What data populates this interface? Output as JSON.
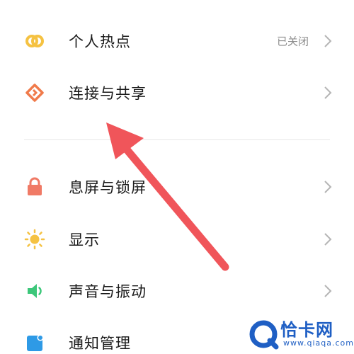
{
  "settings": {
    "hotspot": {
      "label": "个人热点",
      "status": "已关闭",
      "icon": "hotspot-icon",
      "color": "#f5c242"
    },
    "connect_share": {
      "label": "连接与共享",
      "icon": "connection-share-icon",
      "color": "#f07a4a"
    },
    "lock_screen": {
      "label": "息屏与锁屏",
      "icon": "lock-icon",
      "color": "#f07a66"
    },
    "display": {
      "label": "显示",
      "icon": "sun-icon",
      "color": "#f5c242"
    },
    "sound": {
      "label": "声音与振动",
      "icon": "speaker-icon",
      "color": "#3cc77a"
    },
    "notifications": {
      "label": "通知管理",
      "icon": "notification-icon",
      "color": "#2e9ae6"
    }
  },
  "annotation": {
    "icon": "red-arrow-icon",
    "color": "#f0555a"
  },
  "watermark": {
    "brand": "恰卡网",
    "url": "www.qiaqa.com",
    "color": "#1f5fc4"
  }
}
